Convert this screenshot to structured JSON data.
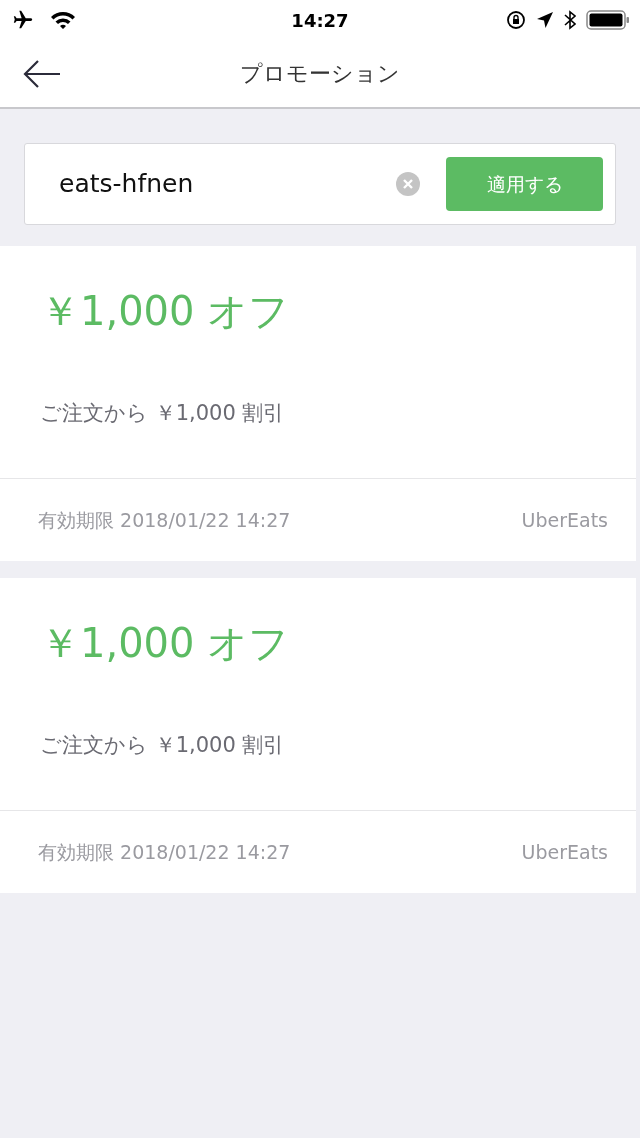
{
  "status_bar": {
    "time": "14:27"
  },
  "nav": {
    "title": "プロモーション"
  },
  "promo_field": {
    "value": "eats-hfnen",
    "button": "適用する"
  },
  "promotions": [
    {
      "title": "￥1,000 オフ",
      "description": "ご注文から ￥1,000 割引",
      "expiry": "有効期限 2018/01/22 14:27",
      "provider": "UberEats"
    },
    {
      "title": "￥1,000 オフ",
      "description": "ご注文から ￥1,000 割引",
      "expiry": "有効期限 2018/01/22 14:27",
      "provider": "UberEats"
    }
  ]
}
